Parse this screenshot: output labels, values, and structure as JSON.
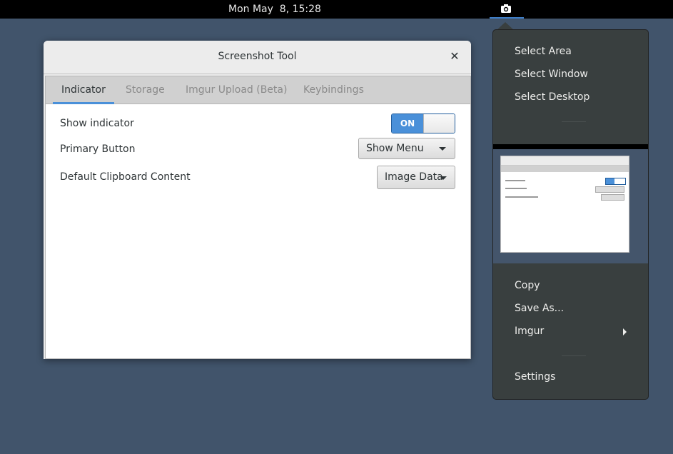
{
  "topbar": {
    "clock": "Mon May  8, 15:28",
    "indicator_icon": "camera-icon"
  },
  "window": {
    "title": "Screenshot Tool",
    "close_icon": "close-icon",
    "tabs": [
      {
        "label": "Indicator",
        "active": true
      },
      {
        "label": "Storage",
        "active": false
      },
      {
        "label": "Imgur Upload (Beta)",
        "active": false
      },
      {
        "label": "Keybindings",
        "active": false
      }
    ],
    "settings": {
      "show_indicator": {
        "label": "Show indicator",
        "state": "ON"
      },
      "primary_button": {
        "label": "Primary Button",
        "value": "Show Menu"
      },
      "clipboard": {
        "label": "Default Clipboard Content",
        "value": "Image Data"
      }
    }
  },
  "menu": {
    "select_items": [
      "Select Area",
      "Select Window",
      "Select Desktop"
    ],
    "action_items": [
      "Copy",
      "Save As...",
      "Imgur"
    ],
    "settings_label": "Settings"
  },
  "colors": {
    "accent": "#4a90d9",
    "desktop": "#41546b",
    "menu_bg": "#393f3f"
  }
}
